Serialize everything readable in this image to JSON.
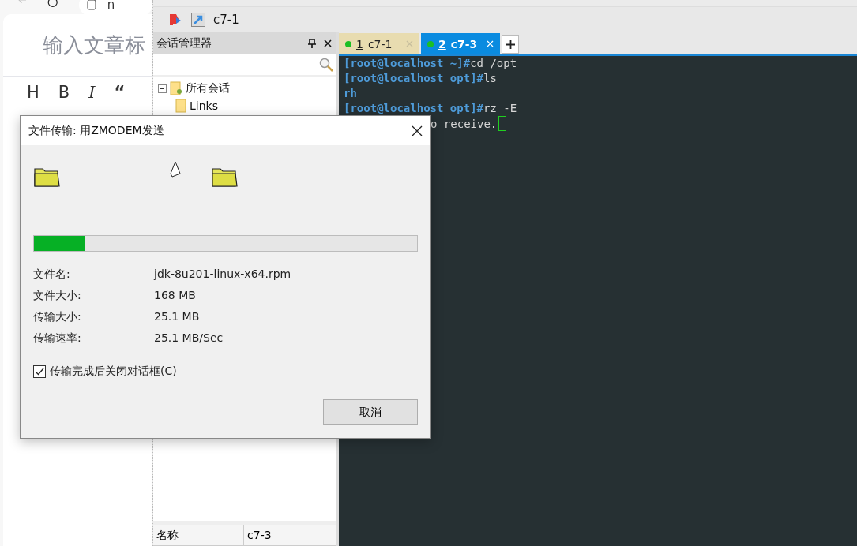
{
  "browser": {
    "address": "n",
    "title_placeholder": "输入文章标",
    "toolbar": [
      "H",
      "B",
      "I",
      "“"
    ]
  },
  "window": {
    "session_title": "c7-1"
  },
  "session_manager": {
    "title": "会话管理器",
    "tree": [
      {
        "label": "所有会话",
        "expanded": true,
        "children": [
          {
            "label": "Links"
          }
        ]
      }
    ],
    "properties": [
      {
        "name": "名称",
        "value": "c7-3"
      }
    ]
  },
  "tabs": [
    {
      "number": "1",
      "label": "c7-1",
      "selected": false
    },
    {
      "number": "2",
      "label": "c7-3",
      "selected": true
    }
  ],
  "terminal": {
    "lines": [
      {
        "kind": "prompt",
        "prompt": "[root@localhost ~]#",
        "command": "cd /opt"
      },
      {
        "kind": "prompt",
        "prompt": "[root@localhost opt]#",
        "command": "ls"
      },
      {
        "kind": "dir",
        "text": "rh"
      },
      {
        "kind": "prompt",
        "prompt": "[root@localhost opt]#",
        "command": "rz -E"
      },
      {
        "kind": "output",
        "text": "o receive.",
        "cursor": true
      }
    ]
  },
  "dialog": {
    "title": "文件传输: 用ZMODEM发送",
    "progress": {
      "level": 0.135
    },
    "fields": [
      {
        "label": "文件名:",
        "value": "jdk-8u201-linux-x64.rpm"
      },
      {
        "label": "文件大小:",
        "value": "168 MB"
      },
      {
        "label": "传输大小:",
        "value": "25.1 MB"
      },
      {
        "label": "传输速率:",
        "value": "25.1 MB/Sec"
      }
    ],
    "close_when_done": {
      "label": "传输完成后关闭对话框(C)",
      "checked": true
    },
    "buttons": [
      "取消"
    ]
  }
}
